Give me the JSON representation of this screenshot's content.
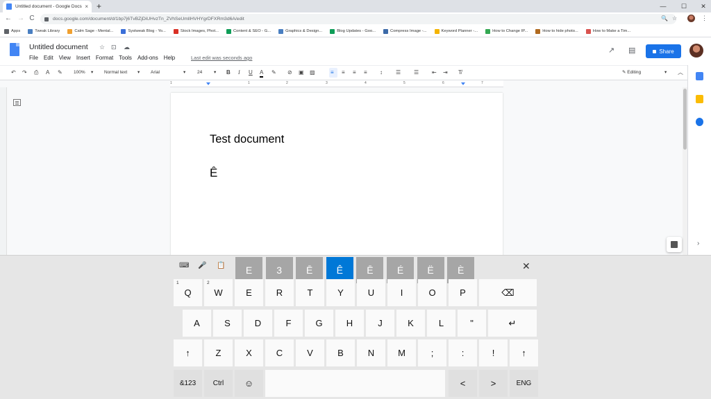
{
  "browser": {
    "tab_title": "Untitled document - Google Docs",
    "tab_close": "×",
    "new_tab": "+",
    "window_controls": [
      "—",
      "☐",
      "✕"
    ],
    "nav": [
      "←",
      "→",
      "C"
    ],
    "url": "docs.google.com/document/d/1bp7j6TvBZjDiUHvzTn_ZVhSeUmllHVHYgrDFXRm3d6A/edit",
    "omni_icons": [
      "🔍",
      "☆"
    ],
    "menu_dots": "⋮"
  },
  "bookmarks": [
    {
      "label": "Apps",
      "color": "#5f6368"
    },
    {
      "label": "Tweak Library",
      "color": "#4a7fc1"
    },
    {
      "label": "Calm Sage - Mental...",
      "color": "#f0a030"
    },
    {
      "label": "Systweak Blog - Yo...",
      "color": "#3a6fd8"
    },
    {
      "label": "Stock Images, Phot...",
      "color": "#d93025"
    },
    {
      "label": "Content & SEO - G...",
      "color": "#0f9d58"
    },
    {
      "label": "Graphics & Design...",
      "color": "#4a7fc1"
    },
    {
      "label": "Blog Updates - Goo...",
      "color": "#0f9d58"
    },
    {
      "label": "Compress Image -...",
      "color": "#3c6aa8"
    },
    {
      "label": "Keyword Planner -...",
      "color": "#f4b400"
    },
    {
      "label": "How to Change IP...",
      "color": "#34a853"
    },
    {
      "label": "How to hide photo...",
      "color": "#b06a20"
    },
    {
      "label": "How to Make a Tim...",
      "color": "#d9534f"
    }
  ],
  "docs": {
    "title": "Untitled document",
    "title_icons": [
      "☆",
      "⊡",
      "☁"
    ],
    "menu": [
      "File",
      "Edit",
      "View",
      "Insert",
      "Format",
      "Tools",
      "Add-ons",
      "Help"
    ],
    "last_edit": "Last edit was seconds ago",
    "header_icons": [
      "↗",
      "▤"
    ],
    "share_label": "Share"
  },
  "toolbar": {
    "undo": "↶",
    "redo": "↷",
    "print": "⎙",
    "spell": "A",
    "paint": "✎",
    "zoom": "100%",
    "style": "Normal text",
    "font": "Arial",
    "size": "24",
    "bold": "B",
    "italic": "I",
    "underline": "U",
    "text_color": "A",
    "highlight": "✎",
    "link": "⊘",
    "comment": "▣",
    "image": "▨",
    "align": [
      "≡",
      "≡",
      "≡",
      "≡"
    ],
    "line_spacing": "↕",
    "lists": [
      "☰",
      "☰",
      "⇤",
      "⇥"
    ],
    "clear": "T̸",
    "editing_label": "Editing",
    "dropdown_caret": "▾",
    "collapse": "︿"
  },
  "ruler": {
    "numbers": [
      "1",
      "1",
      "2",
      "3",
      "4",
      "5",
      "6",
      "7"
    ]
  },
  "document": {
    "line1": "Test document",
    "line2": "Ê"
  },
  "side": {
    "chevron": "›"
  },
  "keyboard": {
    "tools": [
      "⌨",
      "🎤",
      "📋"
    ],
    "candidates": [
      "E",
      "3",
      "Ē",
      "Ê",
      "Ē",
      "É",
      "Ë",
      "È"
    ],
    "selected_index": 3,
    "close": "✕",
    "row1": [
      {
        "label": "Q",
        "num": "1"
      },
      {
        "label": "W",
        "num": "2"
      },
      {
        "label": "E"
      },
      {
        "label": "R"
      },
      {
        "label": "T"
      },
      {
        "label": "Y"
      },
      {
        "label": "U"
      },
      {
        "label": "I"
      },
      {
        "label": "O"
      },
      {
        "label": "P"
      }
    ],
    "backspace": "⌫",
    "row2": [
      "A",
      "S",
      "D",
      "F",
      "G",
      "H",
      "J",
      "K",
      "L",
      "\""
    ],
    "enter": "↵",
    "shift": "↑",
    "row3": [
      "Z",
      "X",
      "C",
      "V",
      "B",
      "N",
      "M",
      ";",
      ":",
      "!"
    ],
    "bottom": {
      "symbols": "&123",
      "ctrl": "Ctrl",
      "emoji": "☺",
      "space": "",
      "left": "<",
      "right": ">",
      "lang": "ENG"
    }
  }
}
